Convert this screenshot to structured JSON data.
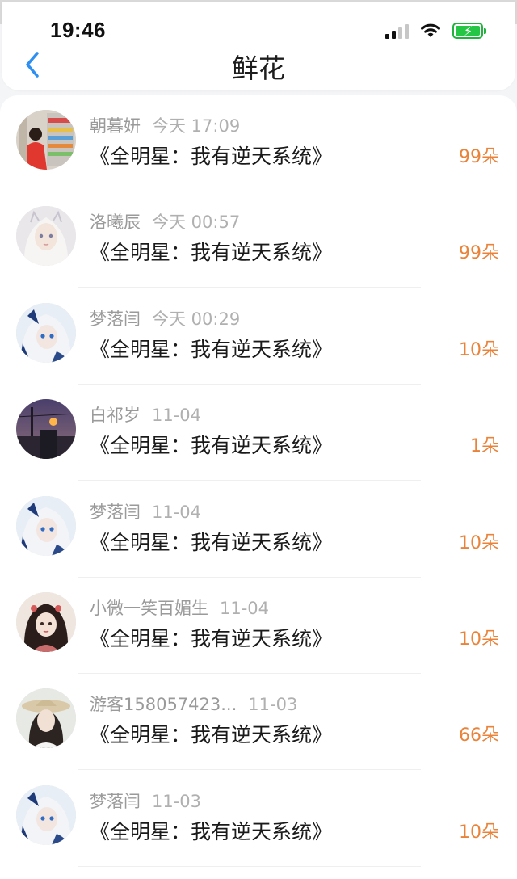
{
  "status_bar": {
    "time": "19:46"
  },
  "header": {
    "title": "鲜花"
  },
  "colors": {
    "accent": "#2c8ff1",
    "count": "#e9833a"
  },
  "items": [
    {
      "name": "朝暮妍",
      "time": "今天 17:09",
      "title": "《全明星：我有逆天系统》",
      "count": "99朵",
      "avatar": "store-photo"
    },
    {
      "name": "洛曦辰",
      "time": "今天 00:57",
      "title": "《全明星：我有逆天系统》",
      "count": "99朵",
      "avatar": "anime-girl-white"
    },
    {
      "name": "梦落闫",
      "time": "今天 00:29",
      "title": "《全明星：我有逆天系统》",
      "count": "10朵",
      "avatar": "anime-girl-blue"
    },
    {
      "name": "白祁岁",
      "time": "11-04",
      "title": "《全明星：我有逆天系统》",
      "count": "1朵",
      "avatar": "dusk-street"
    },
    {
      "name": "梦落闫",
      "time": "11-04",
      "title": "《全明星：我有逆天系统》",
      "count": "10朵",
      "avatar": "anime-girl-blue"
    },
    {
      "name": "小微一笑百媚生",
      "time": "11-04",
      "title": "《全明星：我有逆天系统》",
      "count": "10朵",
      "avatar": "ancient-girl"
    },
    {
      "name": "游客158057423...",
      "time": "11-03",
      "title": "《全明星：我有逆天系统》",
      "count": "66朵",
      "avatar": "girl-hat"
    },
    {
      "name": "梦落闫",
      "time": "11-03",
      "title": "《全明星：我有逆天系统》",
      "count": "10朵",
      "avatar": "anime-girl-blue"
    }
  ]
}
